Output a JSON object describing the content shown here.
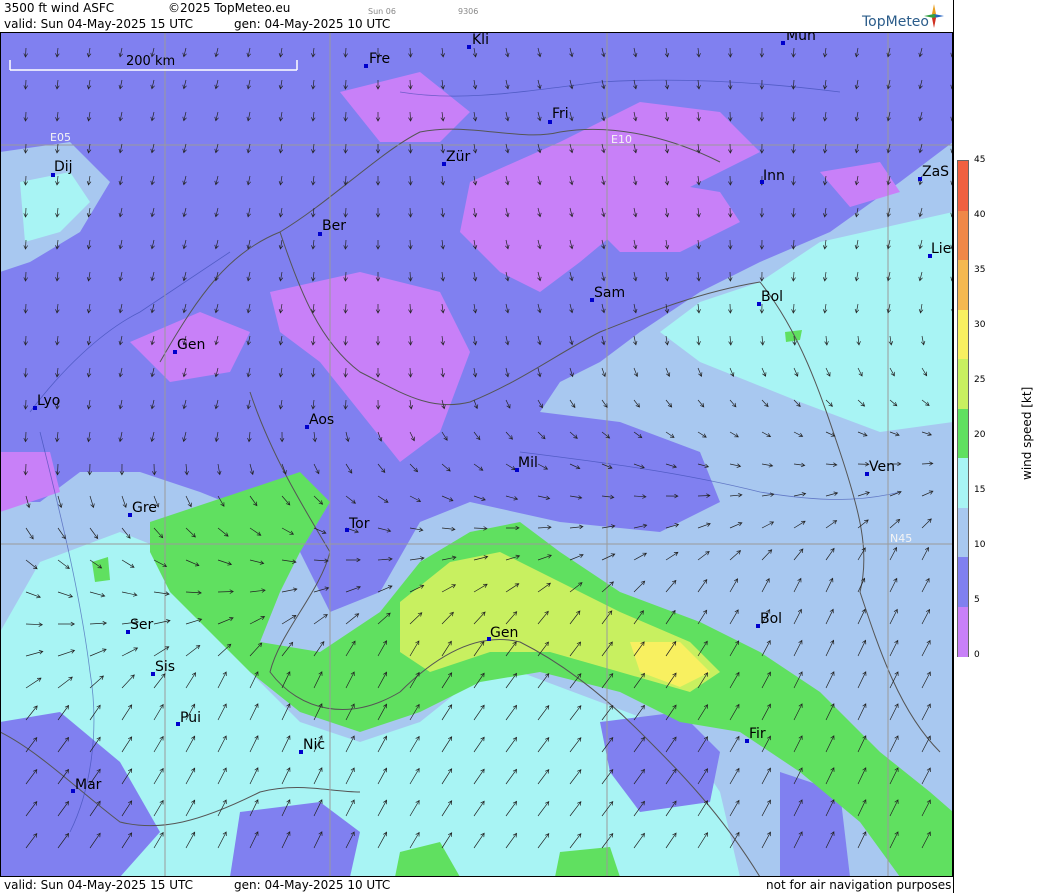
{
  "header": {
    "product": "3500 ft wind ASFC",
    "copyright": "©2025 TopMeteo.eu",
    "day_tab": "Sun 06",
    "code": "9306",
    "valid": "valid:  Sun  04-May-2025  15 UTC",
    "generated": "gen: 04-May-2025 10 UTC",
    "logo": "TopMeteo"
  },
  "scale_bar": {
    "label": "200 km"
  },
  "grid_labels": [
    {
      "text": "E05"
    },
    {
      "text": "E10"
    },
    {
      "text": "N45"
    }
  ],
  "cities": [
    {
      "name": "Fre"
    },
    {
      "name": "Kli"
    },
    {
      "name": "Mün"
    },
    {
      "name": "Fri"
    },
    {
      "name": "Dij"
    },
    {
      "name": "Zür"
    },
    {
      "name": "Inn"
    },
    {
      "name": "ZaS"
    },
    {
      "name": "Ber"
    },
    {
      "name": "Lie"
    },
    {
      "name": "Sam"
    },
    {
      "name": "Bol"
    },
    {
      "name": "Gen"
    },
    {
      "name": "Lyo"
    },
    {
      "name": "Aos"
    },
    {
      "name": "Mil"
    },
    {
      "name": "Ven"
    },
    {
      "name": "Gre"
    },
    {
      "name": "Tor"
    },
    {
      "name": "Ser"
    },
    {
      "name": "Gen"
    },
    {
      "name": "Bol"
    },
    {
      "name": "Sis"
    },
    {
      "name": "Pui"
    },
    {
      "name": "Nic"
    },
    {
      "name": "Fir"
    },
    {
      "name": "Mar"
    }
  ],
  "legend": {
    "title": "wind speed [kt]",
    "ticks": [
      "45",
      "40",
      "35",
      "30",
      "25",
      "20",
      "15",
      "10",
      "5",
      "0"
    ],
    "colors": [
      "#f06040",
      "#f08848",
      "#f4b850",
      "#f8f060",
      "#c8f060",
      "#60e060",
      "#a8f4f4",
      "#a8c8f0",
      "#8080f0",
      "#c880f8"
    ]
  },
  "footer": {
    "valid": "valid:  Sun  04-May-2025  15 UTC",
    "generated": "gen: 04-May-2025 10 UTC",
    "disclaimer": "not for air navigation purposes"
  },
  "palette": {
    "calm": "#c880f8",
    "light": "#8080f0",
    "moderate": "#a8c8f0",
    "fresh": "#a8f4f4",
    "strong": "#60e060",
    "stronger": "#c8f060",
    "peak": "#f8f060"
  }
}
